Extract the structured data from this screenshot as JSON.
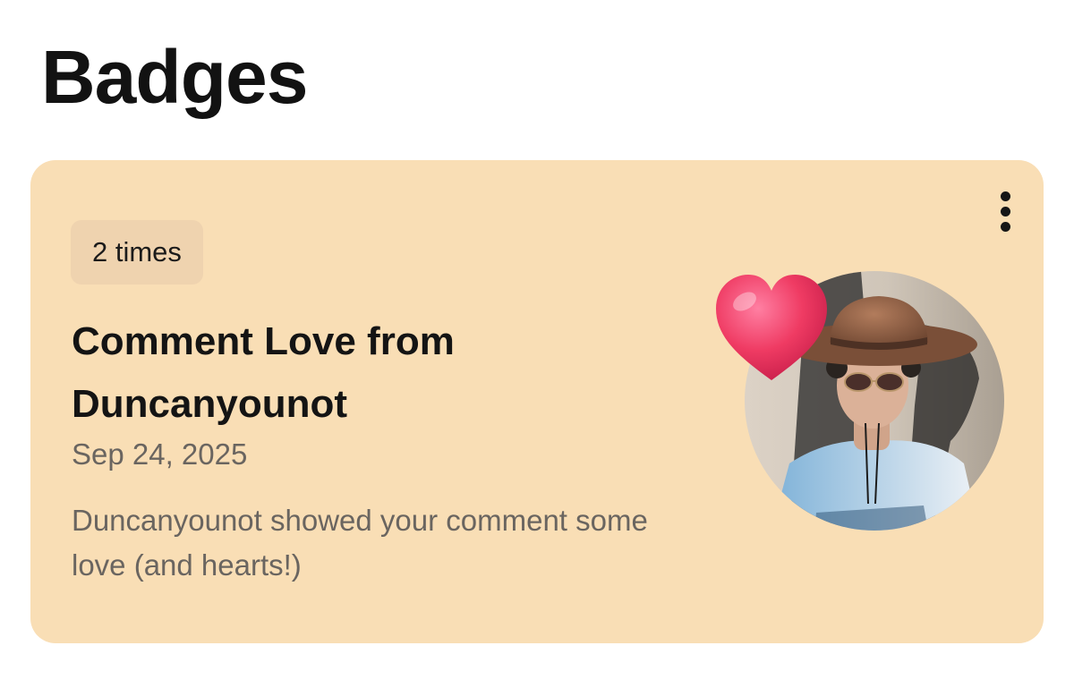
{
  "page": {
    "title": "Badges"
  },
  "badge": {
    "count_label": "2 times",
    "title": "Comment Love from Duncanyounot",
    "date": "Sep 24, 2025",
    "description": "Duncanyounot showed your comment some love (and hearts!)",
    "more_icon": "more-vertical-icon",
    "decoration_icon": "heart-icon",
    "avatar_image": "user-avatar-photo"
  },
  "colors": {
    "card_background": "#f9deb5",
    "pill_background": "#efd3af",
    "title_text": "#141414",
    "secondary_text": "#6a6560",
    "heart": "#e8304f"
  }
}
